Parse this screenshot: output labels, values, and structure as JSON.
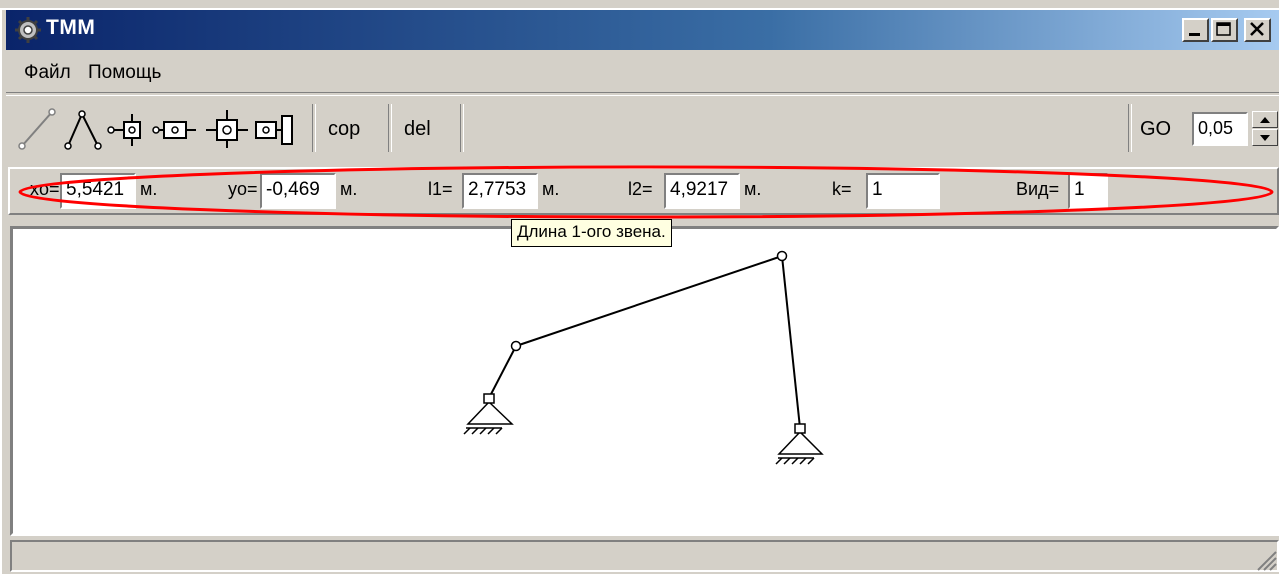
{
  "window": {
    "title": "ТММ"
  },
  "menu": {
    "items": [
      "Файл",
      "Помощь"
    ]
  },
  "toolbar": {
    "tools": [
      {
        "name": "link-line-icon"
      },
      {
        "name": "two-link-joint-icon"
      },
      {
        "name": "slider-icon"
      },
      {
        "name": "slider-block-icon"
      },
      {
        "name": "cross-slider-icon"
      },
      {
        "name": "vertical-slider-icon"
      }
    ],
    "cop_label": "cop",
    "del_label": "del",
    "go_label": "GO",
    "go_value": "0,05"
  },
  "params": {
    "xo": {
      "label": "xo=",
      "value": "5,5421",
      "unit": "м."
    },
    "yo": {
      "label": "yo=",
      "value": "-0,469",
      "unit": "м."
    },
    "l1": {
      "label": "l1=",
      "value": "2,7753",
      "unit": "м."
    },
    "l2": {
      "label": "l2=",
      "value": "4,9217",
      "unit": "м."
    },
    "k": {
      "label": "k=",
      "value": "1"
    },
    "vid": {
      "label": "Вид=",
      "value": "1"
    }
  },
  "tooltip": {
    "text": "Длина 1-ого звена."
  },
  "colors": {
    "titlebar_start": "#0a246a",
    "titlebar_end": "#a6caf0",
    "highlight": "#ff0000"
  }
}
